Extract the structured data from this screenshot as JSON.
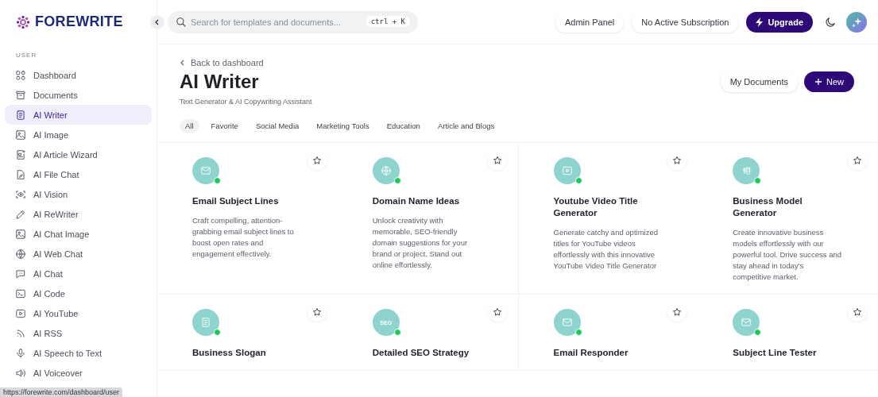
{
  "logo": {
    "text": "FOREWRITE"
  },
  "search": {
    "placeholder": "Search for templates and documents...",
    "shortcut": "ctrl + K"
  },
  "top_actions": [
    "Admin Panel",
    "No Active Subscription"
  ],
  "upgrade": {
    "label": "Upgrade"
  },
  "sidebar": {
    "section": "USER",
    "items": [
      {
        "label": "Dashboard",
        "kind": "grid",
        "selected": false
      },
      {
        "label": "Documents",
        "kind": "archive",
        "selected": false
      },
      {
        "label": "AI Writer",
        "kind": "doc",
        "selected": true
      },
      {
        "label": "AI Image",
        "kind": "image",
        "selected": false
      },
      {
        "label": "AI Article Wizard",
        "kind": "article",
        "selected": false
      },
      {
        "label": "AI File Chat",
        "kind": "file",
        "selected": false
      },
      {
        "label": "AI Vision",
        "kind": "eye",
        "selected": false
      },
      {
        "label": "AI ReWriter",
        "kind": "pen",
        "selected": false
      },
      {
        "label": "AI Chat Image",
        "kind": "image",
        "selected": false
      },
      {
        "label": "AI Web Chat",
        "kind": "globe",
        "selected": false
      },
      {
        "label": "AI Chat",
        "kind": "chat",
        "selected": false
      },
      {
        "label": "AI Code",
        "kind": "terminal",
        "selected": false
      },
      {
        "label": "AI YouTube",
        "kind": "play",
        "selected": false
      },
      {
        "label": "AI RSS",
        "kind": "rss",
        "selected": false
      },
      {
        "label": "AI Speech to Text",
        "kind": "mic",
        "selected": false
      },
      {
        "label": "AI Voiceover",
        "kind": "speaker",
        "selected": false
      }
    ]
  },
  "status_bar": "https://forewrite.com/dashboard/user",
  "back_link": "Back to dashboard",
  "page_title": "AI Writer",
  "page_subtitle": "Text Generator & AI Copywriting Assistant",
  "header_buttons": {
    "documents": "My Documents",
    "new": "New"
  },
  "filters": [
    {
      "label": "All",
      "selected": true
    },
    {
      "label": "Favorite",
      "selected": false
    },
    {
      "label": "Social Media",
      "selected": false
    },
    {
      "label": "Marketing Tools",
      "selected": false
    },
    {
      "label": "Education",
      "selected": false
    },
    {
      "label": "Article and Blogs",
      "selected": false
    }
  ],
  "cards": [
    {
      "title": "Email Subject Lines",
      "description": "Craft compelling, attention-grabbing email subject lines to boost open rates and engagement effectively.",
      "kind": "mail",
      "online": true,
      "favorite": false
    },
    {
      "title": "Domain Name Ideas",
      "description": "Unlock creativity with memorable, SEO-friendly domain suggestions for your brand or project. Stand out online effortlessly.",
      "kind": "globe",
      "online": true,
      "favorite": false
    },
    {
      "title": "Youtube Video Title Generator",
      "description": "Generate catchy and optimized titles for YouTube videos effortlessly with this innovative YouTube Video Title Generator",
      "kind": "play",
      "online": true,
      "favorite": false
    },
    {
      "title": "Business Model Generator",
      "description": "Create innovative business models effortlessly with our powerful tool. Drive success and stay ahead in today's competitive market.",
      "kind": "money",
      "online": true,
      "favorite": false
    },
    {
      "title": "Business Slogan",
      "kind": "doc",
      "online": true,
      "favorite": false
    },
    {
      "title": "Detailed SEO Strategy",
      "kind": "text",
      "icon_text": "SEO",
      "online": true,
      "favorite": false
    },
    {
      "title": "Email Responder",
      "kind": "mail",
      "online": true,
      "favorite": false
    },
    {
      "title": "Subject Line Tester",
      "kind": "mail",
      "online": true,
      "favorite": false
    }
  ]
}
